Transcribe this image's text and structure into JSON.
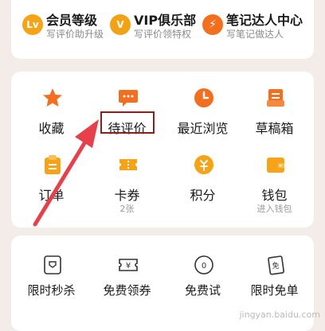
{
  "top": {
    "badges": [
      {
        "icon": "Lv",
        "title": "会员等级",
        "sub": "写评价助升级"
      },
      {
        "icon": "V",
        "title": "VIP俱乐部",
        "sub": "写评价领特权"
      },
      {
        "icon": "⚡",
        "title": "笔记达人中心",
        "sub": "写笔记做达人"
      }
    ]
  },
  "grid": {
    "items": [
      {
        "label": "收藏",
        "sub": ""
      },
      {
        "label": "待评价",
        "sub": ""
      },
      {
        "label": "最近浏览",
        "sub": ""
      },
      {
        "label": "草稿箱",
        "sub": ""
      },
      {
        "label": "订单",
        "sub": ""
      },
      {
        "label": "卡券",
        "sub": "2张"
      },
      {
        "label": "积分",
        "sub": ""
      },
      {
        "label": "钱包",
        "sub": "进入钱包"
      }
    ]
  },
  "bottom": {
    "items": [
      {
        "label": "限时秒杀"
      },
      {
        "label": "免费领券"
      },
      {
        "label": "免费试"
      },
      {
        "label": "限时免单"
      }
    ]
  },
  "watermark": "jingyan.baidu.com",
  "colors": {
    "accent": "#f6a318",
    "orange": "#f36f1f",
    "highlight": "#8b1e1e",
    "arrow": "#e8404a"
  }
}
